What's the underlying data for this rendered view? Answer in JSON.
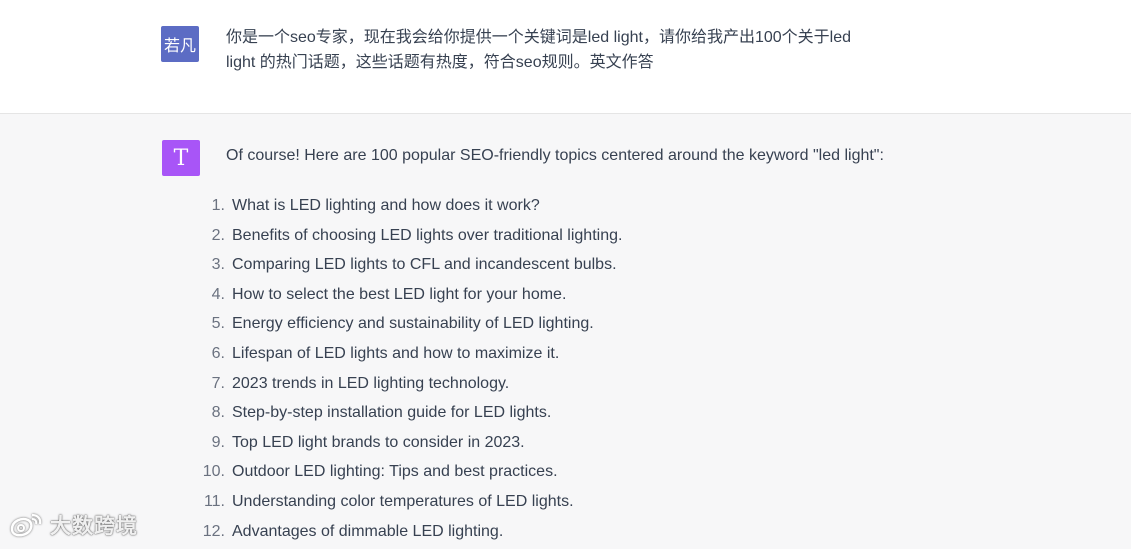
{
  "user_message": {
    "avatar_text": "若凡",
    "avatar_color": "#5c6cc4",
    "line1": "你是一个seo专家，现在我会给你提供一个关键词是led light，请你给我产出100个关于led",
    "line2": "light 的热门话题，这些话题有热度，符合seo规则。英文作答"
  },
  "assistant_message": {
    "avatar_text": "T",
    "avatar_color": "#a855f7",
    "intro": "Of course! Here are 100 popular SEO-friendly topics centered around the keyword \"led light\":",
    "topics": [
      {
        "num": "1.",
        "text": "What is LED lighting and how does it work?"
      },
      {
        "num": "2.",
        "text": "Benefits of choosing LED lights over traditional lighting."
      },
      {
        "num": "3.",
        "text": "Comparing LED lights to CFL and incandescent bulbs."
      },
      {
        "num": "4.",
        "text": "How to select the best LED light for your home."
      },
      {
        "num": "5.",
        "text": "Energy efficiency and sustainability of LED lighting."
      },
      {
        "num": "6.",
        "text": "Lifespan of LED lights and how to maximize it."
      },
      {
        "num": "7.",
        "text": "2023 trends in LED lighting technology."
      },
      {
        "num": "8.",
        "text": "Step-by-step installation guide for LED lights."
      },
      {
        "num": "9.",
        "text": "Top LED light brands to consider in 2023."
      },
      {
        "num": "10.",
        "text": "Outdoor LED lighting: Tips and best practices."
      },
      {
        "num": "11.",
        "text": "Understanding color temperatures of LED lights."
      },
      {
        "num": "12.",
        "text": "Advantages of dimmable LED lighting."
      }
    ]
  },
  "watermark": {
    "text": "大数跨境",
    "icon": "weibo-logo-icon"
  }
}
